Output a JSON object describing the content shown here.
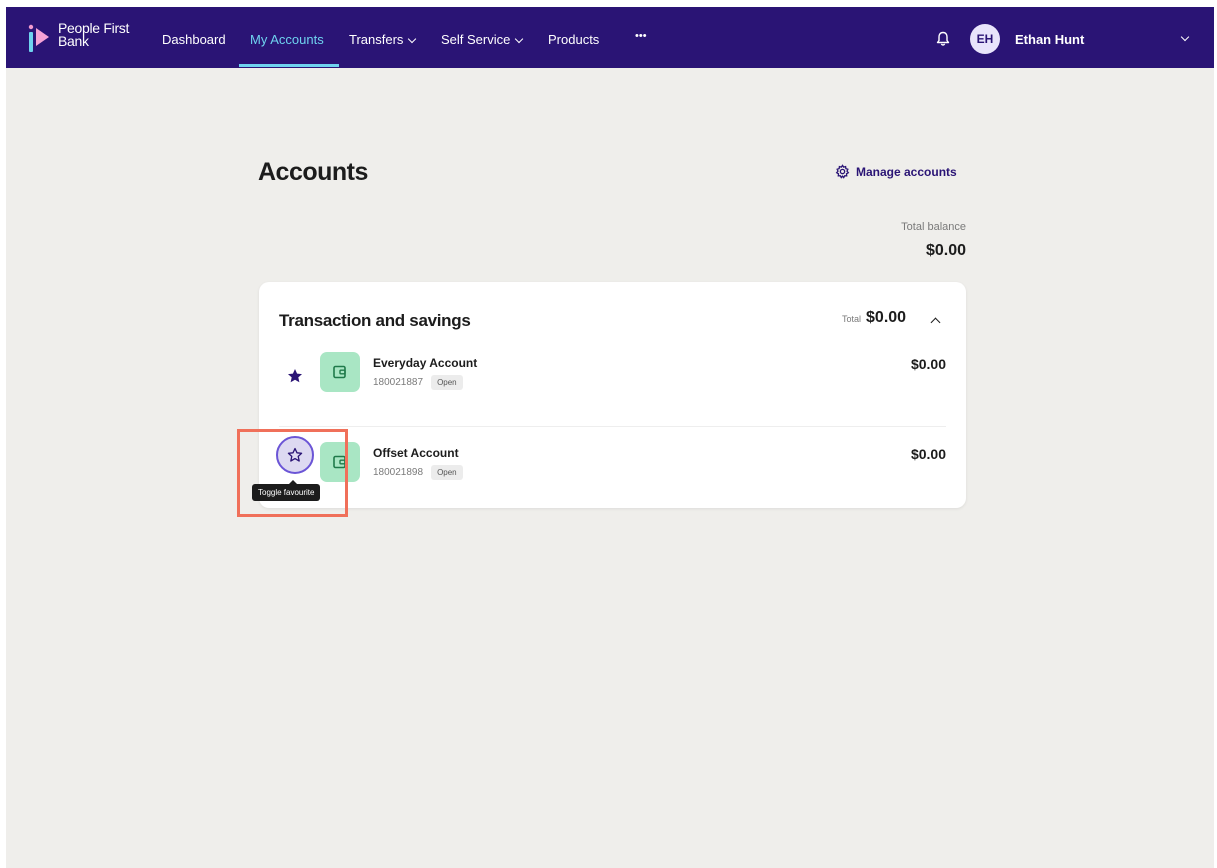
{
  "brand": {
    "name_line1": "People First",
    "name_line2": "Bank"
  },
  "nav": {
    "items": [
      {
        "label": "Dashboard"
      },
      {
        "label": "My Accounts"
      },
      {
        "label": "Transfers"
      },
      {
        "label": "Self Service"
      },
      {
        "label": "Products"
      },
      {
        "label": "•••"
      }
    ],
    "active_index": 1
  },
  "user": {
    "initials": "EH",
    "name": "Ethan Hunt"
  },
  "page": {
    "title": "Accounts",
    "manage_label": "Manage accounts",
    "total_balance_label": "Total balance",
    "total_balance_value": "$0.00"
  },
  "group": {
    "title": "Transaction and savings",
    "total_label": "Total",
    "total_value": "$0.00",
    "accounts": [
      {
        "name": "Everyday Account",
        "number": "180021887",
        "status": "Open",
        "balance": "$0.00",
        "favourite": true
      },
      {
        "name": "Offset Account",
        "number": "180021898",
        "status": "Open",
        "balance": "$0.00",
        "favourite": false
      }
    ]
  },
  "tooltip": {
    "text": "Toggle favourite"
  },
  "colors": {
    "nav_bg": "#2a1475",
    "active_link": "#6fd3ef",
    "account_icon_bg": "#a9e6c4",
    "highlight": "#f0705a"
  }
}
